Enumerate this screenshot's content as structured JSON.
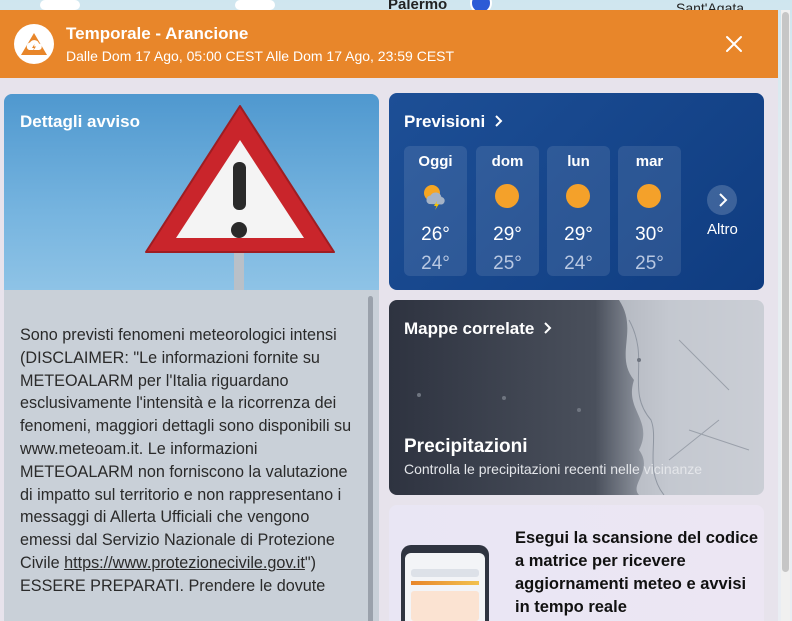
{
  "map": {
    "label_left": "Palermo",
    "label_right": "Sant'Agata"
  },
  "alert": {
    "title": "Temporale - Arancione",
    "subtitle": "Dalle Dom 17 Ago, 05:00 CEST Alle Dom 17 Ago, 23:59 CEST",
    "color": "#e8862a",
    "icon": "storm-cloud-icon",
    "close_icon": "close-icon"
  },
  "details": {
    "title": "Dettagli avviso",
    "hero_icon": "warning-triangle-icon",
    "body_part1": "Sono previsti fenomeni meteorologici intensi (DISCLAIMER: \"Le informazioni fornite su METEOALARM per l'Italia riguardano esclusivamente l'intensità e la ricorrenza dei fenomeni, maggiori dettagli sono disponibili su www.meteoam.it. Le informazioni METEOALARM non forniscono la valutazione di impatto sul territorio e non rappresentano i messaggi di Allerta Ufficiali che vengono emessi dal Servizio Nazionale di Protezione Civile ",
    "link": "https://www.protezionecivile.gov.it",
    "body_part2": "\") ESSERE PREPARATI. Prendere le dovute"
  },
  "forecast": {
    "title": "Previsioni",
    "days": [
      {
        "name": "Oggi",
        "icon": "sun-storm-icon",
        "hi": "26°",
        "lo": "24°"
      },
      {
        "name": "dom",
        "icon": "sun-icon",
        "hi": "29°",
        "lo": "25°"
      },
      {
        "name": "lun",
        "icon": "sun-icon",
        "hi": "29°",
        "lo": "24°"
      },
      {
        "name": "mar",
        "icon": "sun-icon",
        "hi": "30°",
        "lo": "25°"
      }
    ],
    "more_label": "Altro"
  },
  "maps": {
    "title": "Mappe correlate",
    "heading": "Precipitazioni",
    "description": "Controlla le precipitazioni recenti nelle vicinanze"
  },
  "qr": {
    "text": "Esegui la scansione del codice a matrice per ricevere aggiornamenti meteo e avvisi in tempo reale"
  }
}
